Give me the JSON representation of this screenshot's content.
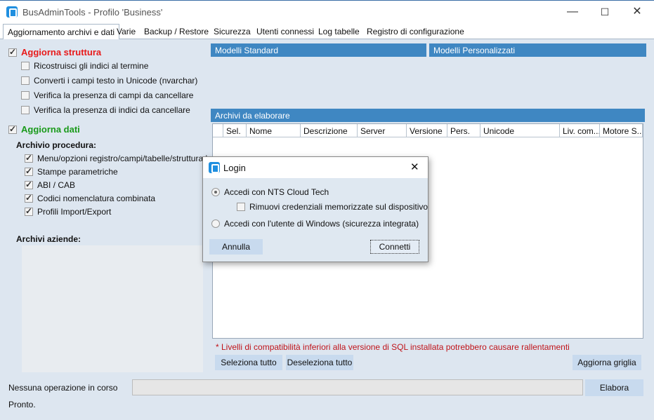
{
  "window": {
    "title": "BusAdminTools - Profilo 'Business'",
    "minimize": "—",
    "maximize": "☐",
    "close": "✕"
  },
  "tabs": [
    {
      "label": "Aggiornamento archivi e dati"
    },
    {
      "label": "Varie"
    },
    {
      "label": "Backup / Restore"
    },
    {
      "label": "Sicurezza"
    },
    {
      "label": "Utenti connessi"
    },
    {
      "label": "Log tabelle"
    },
    {
      "label": "Registro di configurazione"
    }
  ],
  "left": {
    "aggiorna_struttura": {
      "label": "Aggiorna struttura",
      "checked": true,
      "color": "#e81a1a"
    },
    "struttura_options": [
      {
        "label": "Ricostruisci gli indici al termine",
        "checked": false
      },
      {
        "label": "Converti i campi testo in Unicode (nvarchar)",
        "checked": false
      },
      {
        "label": "Verifica la presenza di campi da cancellare",
        "checked": false
      },
      {
        "label": "Verifica la presenza di indici da cancellare",
        "checked": false
      }
    ],
    "aggiorna_dati": {
      "label": "Aggiorna dati",
      "checked": true,
      "color": "#1a9a1a"
    },
    "archivio_procedura_label": "Archivio procedura:",
    "procedura_options": [
      {
        "label": "Menu/opzioni registro/campi/tabelle/struttura log",
        "checked": true
      },
      {
        "label": "Stampe parametriche",
        "checked": true
      },
      {
        "label": "ABI / CAB",
        "checked": true
      },
      {
        "label": "Codici nomenclatura combinata",
        "checked": true
      },
      {
        "label": "Profili Import/Export",
        "checked": true
      }
    ],
    "archivi_aziende_label": "Archivi aziende:"
  },
  "right": {
    "modelli_standard": "Modelli Standard",
    "modelli_personalizzati": "Modelli Personalizzati",
    "archivi_header": "Archivi da elaborare",
    "columns": [
      "",
      "Sel.",
      "Nome",
      "Descrizione",
      "Server",
      "Versione",
      "Pers.",
      "Unicode",
      "Liv. com...",
      "Motore S..."
    ],
    "warning": "* Livelli di compatibilità inferiori alla versione di SQL installata potrebbero causare rallentamenti",
    "seleziona_tutto": "Seleziona tutto",
    "deseleziona_tutto": "Deseleziona tutto",
    "aggiorna_griglia": "Aggiorna griglia"
  },
  "status": {
    "operation": "Nessuna operazione in corso",
    "elabora": "Elabora",
    "ready": "Pronto."
  },
  "dialog": {
    "title": "Login",
    "close": "✕",
    "option_cloud": "Accedi con NTS Cloud Tech",
    "remove_credentials": "Rimuovi credenziali memorizzate sul dispositivo",
    "option_windows": "Accedi con l'utente di Windows (sicurezza integrata)",
    "selected": "cloud",
    "annulla": "Annulla",
    "connetti": "Connetti"
  },
  "colors": {
    "accent": "#3f87c2",
    "background": "#dde6f0",
    "button": "#c8daee"
  }
}
